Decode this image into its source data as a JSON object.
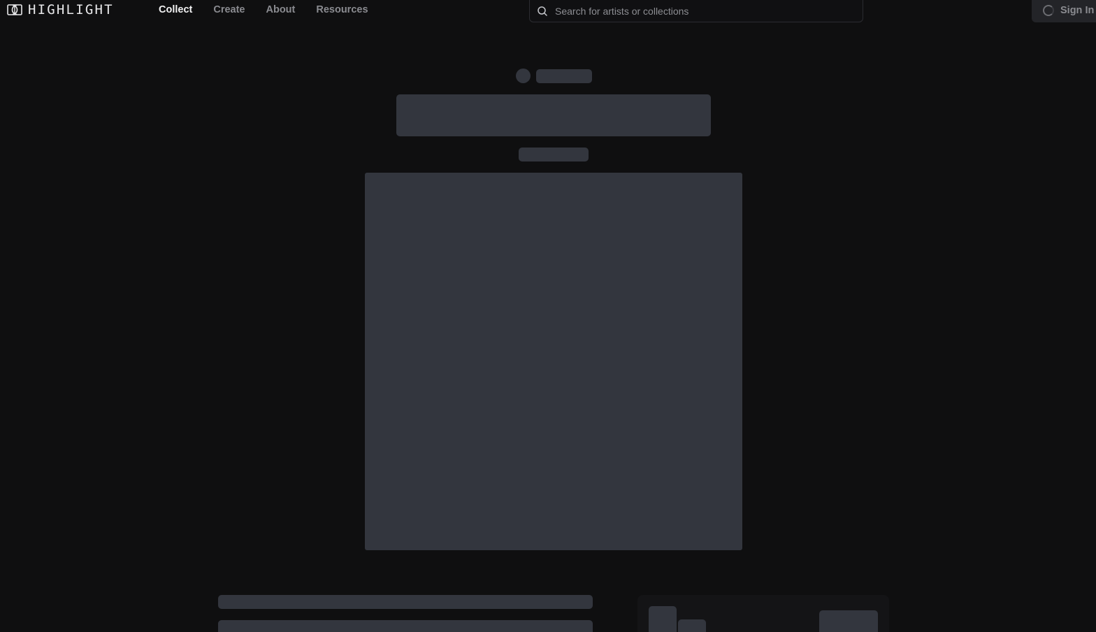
{
  "header": {
    "logo": {
      "icon": "highlight-logo-icon",
      "text": "HIGHLIGHT"
    },
    "nav": [
      {
        "label": "Collect",
        "active": true
      },
      {
        "label": "Create",
        "active": false
      },
      {
        "label": "About",
        "active": false
      },
      {
        "label": "Resources",
        "active": false
      }
    ],
    "search": {
      "placeholder": "Search for artists or collections",
      "value": "",
      "icon": "search-icon"
    },
    "signin": {
      "label": "Sign In",
      "icon": "loading-spinner-icon"
    }
  },
  "colors": {
    "background": "#0f0f10",
    "skeleton": "#33363e",
    "nav_active": "#f2f2f3",
    "nav_inactive": "#8a8b90",
    "signin_bg": "#232428",
    "panel_bg": "#141416"
  },
  "main": {
    "state": "loading"
  }
}
